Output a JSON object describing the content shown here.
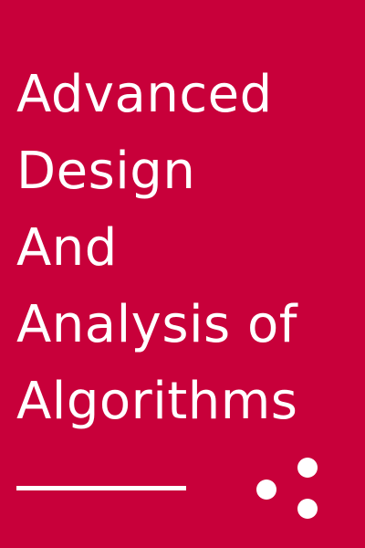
{
  "cover": {
    "title_lines": [
      "Advanced",
      "Design",
      "And",
      "Analysis of",
      "Algorithms"
    ],
    "background_color": "#c8003a",
    "text_color": "#ffffff"
  },
  "decorations": {
    "dots_icon": "three-dots-logo-icon"
  }
}
